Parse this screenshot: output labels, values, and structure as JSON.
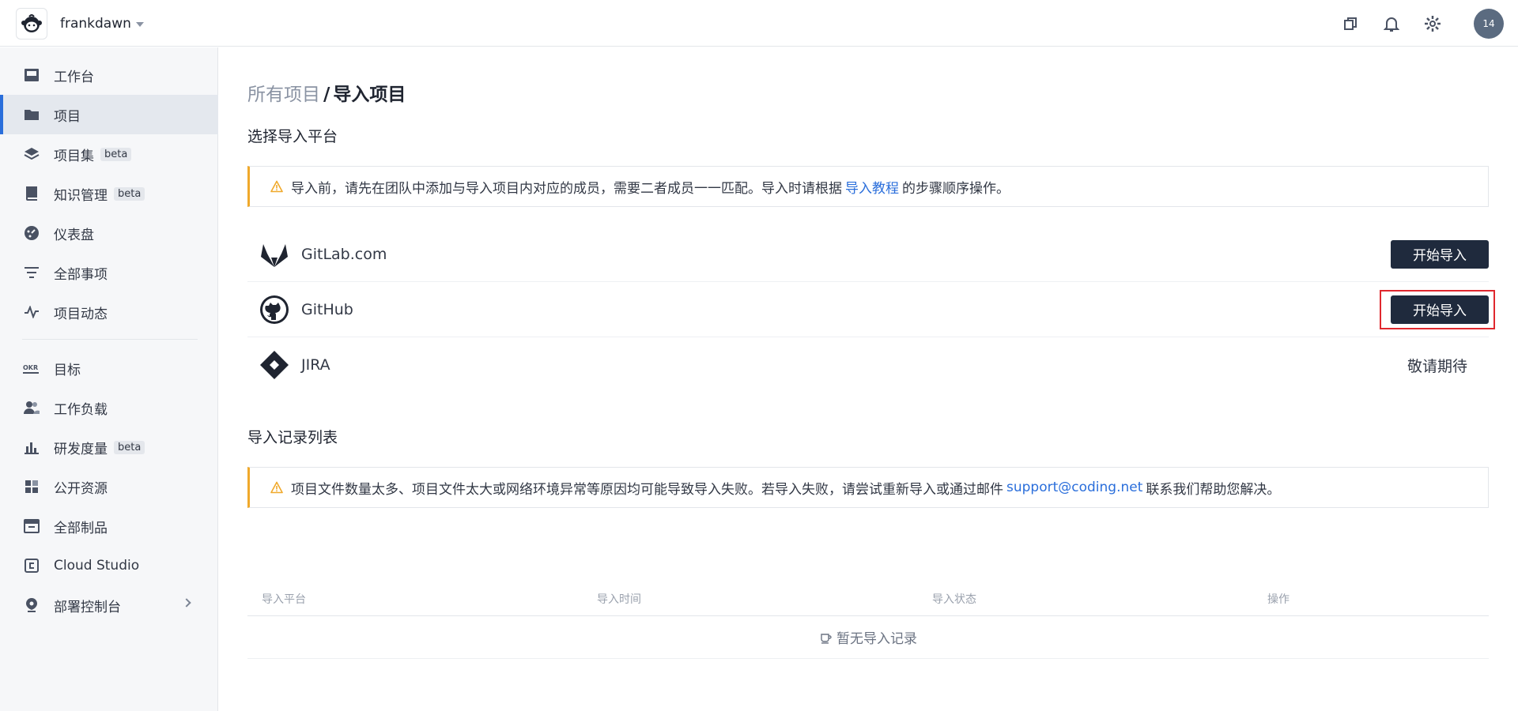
{
  "header": {
    "team_name": "frankdawn",
    "avatar_text": "14",
    "icons": [
      "copy-icon",
      "bell-icon",
      "gear-icon"
    ]
  },
  "sidebar": {
    "items": [
      {
        "label": "工作台",
        "icon": "workbench-icon"
      },
      {
        "label": "项目",
        "icon": "folder-icon",
        "active": true
      },
      {
        "label": "项目集",
        "icon": "layers-icon",
        "badge": "beta"
      },
      {
        "label": "知识管理",
        "icon": "book-icon",
        "badge": "beta"
      },
      {
        "label": "仪表盘",
        "icon": "dashboard-icon"
      },
      {
        "label": "全部事项",
        "icon": "filter-icon"
      },
      {
        "label": "项目动态",
        "icon": "activity-icon"
      },
      {
        "label": "目标",
        "icon": "okr-icon"
      },
      {
        "label": "工作负载",
        "icon": "users-icon"
      },
      {
        "label": "研发度量",
        "icon": "bar-chart-icon",
        "badge": "beta"
      },
      {
        "label": "公开资源",
        "icon": "grid-icon"
      },
      {
        "label": "全部制品",
        "icon": "artifact-icon"
      },
      {
        "label": "Cloud Studio",
        "icon": "cloud-studio-icon"
      },
      {
        "label": "部署控制台",
        "icon": "deploy-icon",
        "has_submenu": true
      }
    ]
  },
  "main": {
    "breadcrumb": {
      "parent": "所有项目",
      "separator": "/",
      "current": "导入项目"
    },
    "platform_section_title": "选择导入平台",
    "platform_notice": {
      "before": "导入前，请先在团队中添加与导入项目内对应的成员，需要二者成员一一匹配。导入时请根据",
      "link": "导入教程",
      "after": "的步骤顺序操作。"
    },
    "platforms": [
      {
        "name": "GitLab.com",
        "action": "开始导入",
        "icon": "gitlab-icon"
      },
      {
        "name": "GitHub",
        "action": "开始导入",
        "icon": "github-icon"
      },
      {
        "name": "JIRA",
        "status": "敬请期待",
        "icon": "jira-icon"
      }
    ],
    "records_section_title": "导入记录列表",
    "records_notice": {
      "before": "项目文件数量太多、项目文件太大或网络环境异常等原因均可能导致导入失败。若导入失败，请尝试重新导入或通过邮件",
      "link": "support@coding.net",
      "after": "联系我们帮助您解决。"
    },
    "table": {
      "columns": [
        "导入平台",
        "导入时间",
        "导入状态",
        "操作"
      ],
      "empty_text": "暂无导入记录"
    }
  },
  "colors": {
    "primary_button": "#1f2a3d",
    "link": "#2a6edb",
    "warning": "#f0a92b",
    "active_indicator": "#2a6edb",
    "highlight": "#e0282e"
  }
}
